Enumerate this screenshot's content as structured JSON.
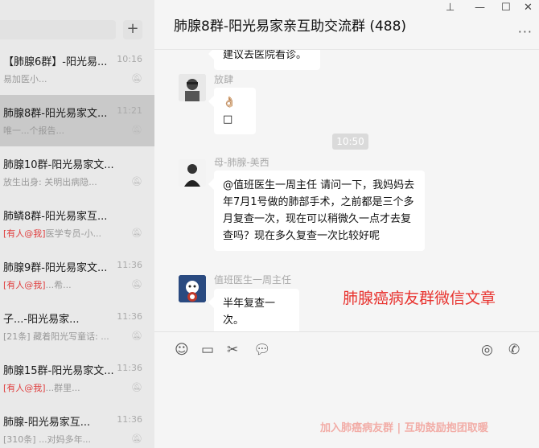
{
  "sidebar": {
    "search_icon": "search-icon",
    "add_label": "+",
    "chats": [
      {
        "name": "【肺腺6群】-阳光易...",
        "preview": "易加医小...",
        "time": "10:16",
        "mention": "",
        "selected": false
      },
      {
        "name": "肺腺8群-阳光易家文...",
        "preview": "唯一...个报告...",
        "time": "11:21",
        "mention": "",
        "selected": true
      },
      {
        "name": "肺腺10群-阳光易家文...",
        "preview": "放生出身: 关明出病隐...",
        "time": "",
        "mention": "",
        "selected": false
      },
      {
        "name": "肺鳞8群-阳光易家互...",
        "preview": "医学专员-小...",
        "time": "",
        "mention": "[有人@我]",
        "selected": false
      },
      {
        "name": "肺腺9群-阳光易家文...",
        "preview": "...希...",
        "time": "11:36",
        "mention": "[有人@我]",
        "selected": false
      },
      {
        "name": "子...-阳光易家...",
        "preview": "[21条] 藏着阳光写童话: ...",
        "time": "11:36",
        "mention": "",
        "selected": false
      },
      {
        "name": "肺腺15群-阳光易家文...",
        "preview": "...群里...",
        "time": "11:36",
        "mention": "[有人@我]",
        "selected": false
      },
      {
        "name": "肺腺-阳光易家互...",
        "preview": "[310条] ...对妈多年...",
        "time": "11:36",
        "mention": "",
        "selected": false
      }
    ]
  },
  "header": {
    "title": "肺腺8群-阳光易家亲互助交流群 (488)",
    "pin_icon": "pin-icon",
    "minimize_icon": "minimize-icon",
    "maximize_icon": "maximize-icon",
    "close_icon": "close-icon",
    "more_label": "···"
  },
  "messages": {
    "top_bubble": "建议去医院看诊。",
    "msg1": {
      "sender": "放肆",
      "text": "👌🏼 □"
    },
    "time_divider": "10:50",
    "msg2": {
      "sender": "母-肺腺-美西",
      "text": "@值班医生一周主任 请问一下，我妈妈去年7月1号做的肺部手术，之前都是三个多月复查一次，现在可以稍微久一点才去复查吗？现在多久复查一次比较好呢"
    },
    "msg3": {
      "sender": "值班医生一周主任",
      "text": "半年复查一次。"
    },
    "overlay_caption": "肺腺癌病友群微信文章"
  },
  "toolbar": {
    "icons": [
      "emoji-icon",
      "folder-icon",
      "scissors-icon",
      "chat-bubble-icon",
      "voice-call-icon",
      "video-call-icon"
    ],
    "footer_caption": "加入肺癌病友群 | 互助鼓励抱团取暖"
  }
}
